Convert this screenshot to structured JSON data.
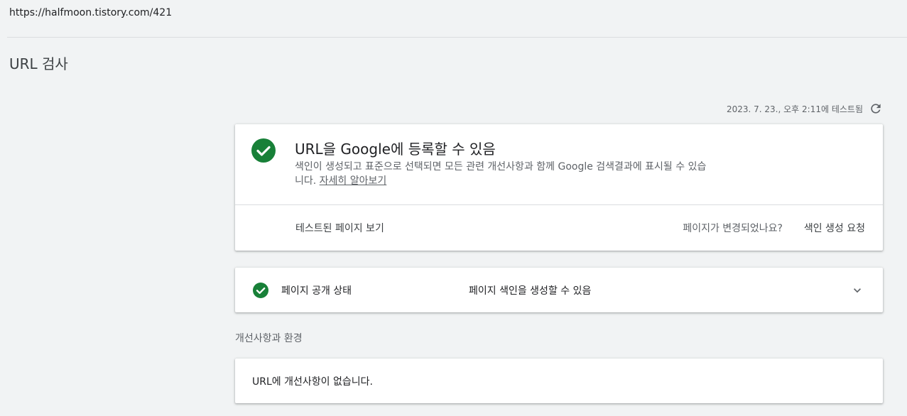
{
  "url": "https://halfmoon.tistory.com/421",
  "page_title": "URL 검사",
  "tested_at": "2023. 7. 23., 오후 2:11에 테스트됨",
  "main_card": {
    "title": "URL을 Google에 등록할 수 있음",
    "description": "색인이 생성되고 표준으로 선택되면 모든 관련 개선사항과 함께 Google 검색결과에 표시될 수 있습니다.",
    "learn_more": "자세히 알아보기",
    "view_tested_page": "테스트된 페이지 보기",
    "page_changed_question": "페이지가 변경되었나요?",
    "request_indexing": "색인 생성 요청"
  },
  "availability": {
    "label": "페이지 공개 상태",
    "value": "페이지 색인을 생성할 수 있음"
  },
  "enhancements": {
    "heading": "개선사항과 환경",
    "message": "URL에 개선사항이 없습니다."
  },
  "colors": {
    "success_green": "#188038",
    "background": "#f1f3f4",
    "card": "#ffffff"
  },
  "icons": {
    "refresh": "refresh-icon",
    "check_big": "check-circle-icon",
    "check_small": "check-circle-icon",
    "expand": "chevron-down-icon"
  }
}
